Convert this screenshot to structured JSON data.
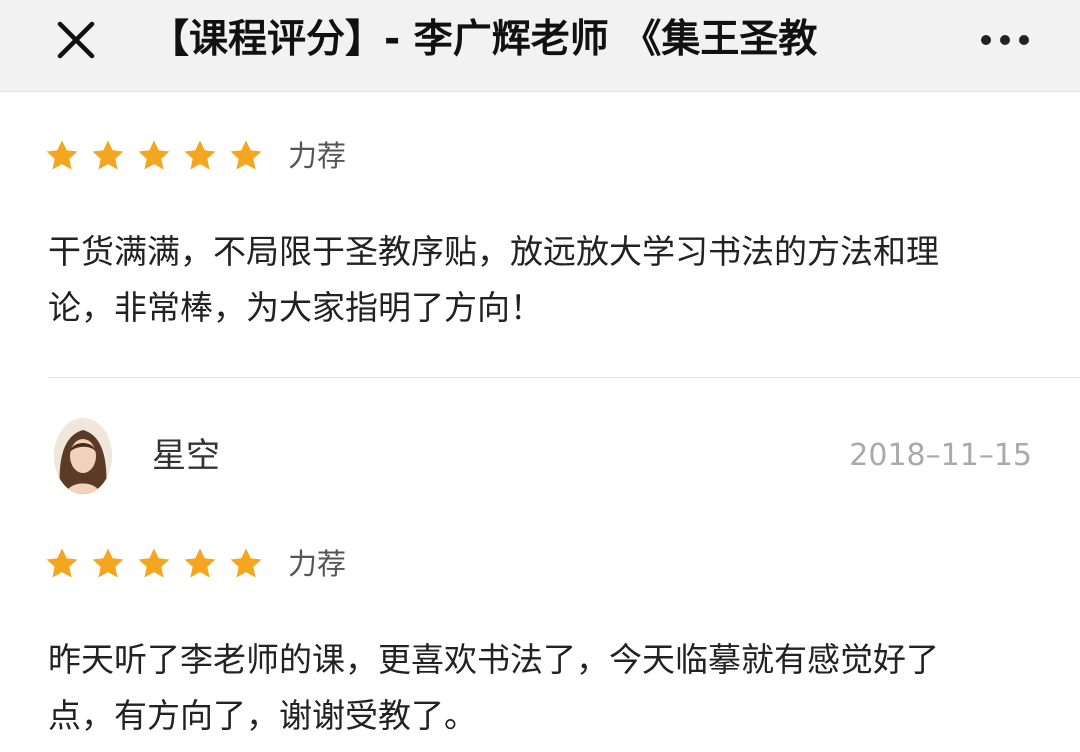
{
  "header": {
    "title": "【课程评分】- 李广辉老师 《集王圣教"
  },
  "reviews": [
    {
      "rating": 5,
      "rating_label": "力荐",
      "text_line1": "干货满满，不局限于圣教序贴，放远放大学习书法的方法和理",
      "text_line2": "论，非常棒，为大家指明了方向！"
    },
    {
      "username": "星空",
      "date": "2018–11–15",
      "rating": 5,
      "rating_label": "力荐",
      "text_line1": "昨天听了李老师的课，更喜欢书法了，今天临摹就有感觉好了",
      "text_line2": "点，有方向了，谢谢受教了。"
    }
  ],
  "colors": {
    "star": "#f4a620",
    "header_bg": "#f2f2f2"
  },
  "icons": {
    "close": "close-icon",
    "more": "more-dots-icon",
    "star": "star-icon"
  }
}
